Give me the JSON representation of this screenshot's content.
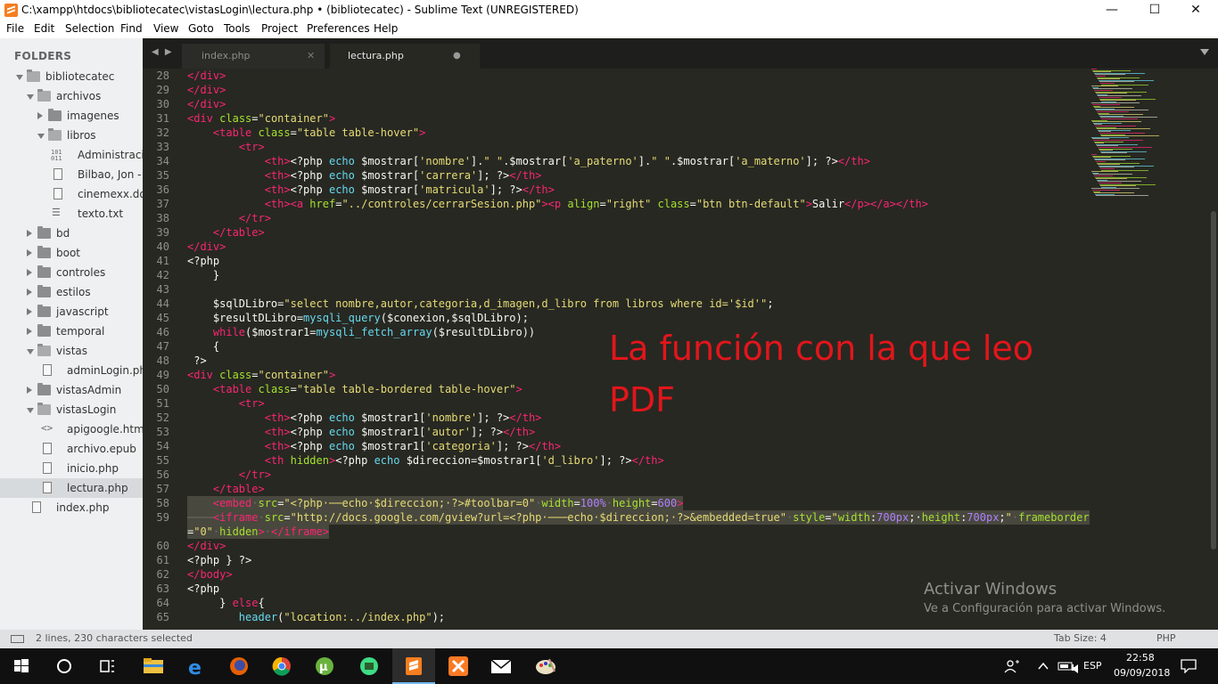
{
  "window": {
    "title": "C:\\xampp\\htdocs\\bibliotecatec\\vistasLogin\\lectura.php • (bibliotecatec) - Sublime Text (UNREGISTERED)",
    "minimize": "—",
    "maximize": "☐",
    "close": "✕"
  },
  "menu": [
    "File",
    "Edit",
    "Selection",
    "Find",
    "View",
    "Goto",
    "Tools",
    "Project",
    "Preferences",
    "Help"
  ],
  "sidebar": {
    "heading": "FOLDERS",
    "items": [
      {
        "label": "bibliotecatec",
        "type": "folder",
        "open": true,
        "depth": 0
      },
      {
        "label": "archivos",
        "type": "folder",
        "open": true,
        "depth": 1
      },
      {
        "label": "imagenes",
        "type": "folder",
        "open": false,
        "depth": 2
      },
      {
        "label": "libros",
        "type": "folder",
        "open": true,
        "depth": 2
      },
      {
        "label": "Administracin",
        "type": "binary-file",
        "depth": 3
      },
      {
        "label": "Bilbao, Jon - E",
        "type": "file",
        "depth": 3
      },
      {
        "label": "cinemexx.docx",
        "type": "file",
        "depth": 3
      },
      {
        "label": "texto.txt",
        "type": "text-file",
        "depth": 3
      },
      {
        "label": "bd",
        "type": "folder",
        "open": false,
        "depth": 1
      },
      {
        "label": "boot",
        "type": "folder",
        "open": false,
        "depth": 1
      },
      {
        "label": "controles",
        "type": "folder",
        "open": false,
        "depth": 1
      },
      {
        "label": "estilos",
        "type": "folder",
        "open": false,
        "depth": 1
      },
      {
        "label": "javascript",
        "type": "folder",
        "open": false,
        "depth": 1
      },
      {
        "label": "temporal",
        "type": "folder",
        "open": false,
        "depth": 1
      },
      {
        "label": "vistas",
        "type": "folder",
        "open": true,
        "depth": 1
      },
      {
        "label": "adminLogin.php",
        "type": "file",
        "depth": 2
      },
      {
        "label": "vistasAdmin",
        "type": "folder",
        "open": false,
        "depth": 1
      },
      {
        "label": "vistasLogin",
        "type": "folder",
        "open": true,
        "depth": 1
      },
      {
        "label": "apigoogle.html",
        "type": "code-file",
        "depth": 2
      },
      {
        "label": "archivo.epub",
        "type": "file",
        "depth": 2
      },
      {
        "label": "inicio.php",
        "type": "file",
        "depth": 2
      },
      {
        "label": "lectura.php",
        "type": "file",
        "depth": 2,
        "selected": true
      },
      {
        "label": "index.php",
        "type": "file",
        "depth": 1
      }
    ]
  },
  "tabs": {
    "nav": "◀ ▶",
    "inactive": {
      "label": "index.php",
      "close": "✕"
    },
    "active": {
      "label": "lectura.php",
      "close": "●"
    }
  },
  "editor": {
    "lines": [
      {
        "n": "28",
        "tokens": [
          [
            "t",
            "</div>"
          ]
        ]
      },
      {
        "n": "29",
        "tokens": [
          [
            "t",
            "</div>"
          ]
        ]
      },
      {
        "n": "30",
        "tokens": [
          [
            "t",
            "</div>"
          ]
        ]
      },
      {
        "n": "31",
        "tokens": [
          [
            "t",
            "<div"
          ],
          [
            "v",
            " "
          ],
          [
            "a",
            "class"
          ],
          [
            "v",
            "="
          ],
          [
            "s",
            "\"container\""
          ],
          [
            "t",
            ">"
          ]
        ]
      },
      {
        "n": "32",
        "tokens": [
          [
            "v",
            "    "
          ],
          [
            "t",
            "<table"
          ],
          [
            "v",
            " "
          ],
          [
            "a",
            "class"
          ],
          [
            "v",
            "="
          ],
          [
            "s",
            "\"table table-hover\""
          ],
          [
            "t",
            ">"
          ]
        ]
      },
      {
        "n": "33",
        "tokens": [
          [
            "v",
            "        "
          ],
          [
            "t",
            "<tr>"
          ]
        ]
      },
      {
        "n": "34",
        "tokens": [
          [
            "v",
            "            "
          ],
          [
            "t",
            "<th>"
          ],
          [
            "v",
            "<?php "
          ],
          [
            "k",
            "echo"
          ],
          [
            "v",
            " $mostrar["
          ],
          [
            "s",
            "'nombre'"
          ],
          [
            "v",
            "]."
          ],
          [
            "s",
            "\" \""
          ],
          [
            "v",
            ".$mostrar["
          ],
          [
            "s",
            "'a_paterno'"
          ],
          [
            "v",
            "]."
          ],
          [
            "s",
            "\" \""
          ],
          [
            "v",
            ".$mostrar["
          ],
          [
            "s",
            "'a_materno'"
          ],
          [
            "v",
            "]; ?>"
          ],
          [
            "t",
            "</th>"
          ]
        ]
      },
      {
        "n": "35",
        "tokens": [
          [
            "v",
            "            "
          ],
          [
            "t",
            "<th>"
          ],
          [
            "v",
            "<?php "
          ],
          [
            "k",
            "echo"
          ],
          [
            "v",
            " $mostrar["
          ],
          [
            "s",
            "'carrera'"
          ],
          [
            "v",
            "]; ?>"
          ],
          [
            "t",
            "</th>"
          ]
        ]
      },
      {
        "n": "36",
        "tokens": [
          [
            "v",
            "            "
          ],
          [
            "t",
            "<th>"
          ],
          [
            "v",
            "<?php "
          ],
          [
            "k",
            "echo"
          ],
          [
            "v",
            " $mostrar["
          ],
          [
            "s",
            "'matricula'"
          ],
          [
            "v",
            "]; ?>"
          ],
          [
            "t",
            "</th>"
          ]
        ]
      },
      {
        "n": "37",
        "tokens": [
          [
            "v",
            "            "
          ],
          [
            "t",
            "<th><a"
          ],
          [
            "v",
            " "
          ],
          [
            "a",
            "href"
          ],
          [
            "v",
            "="
          ],
          [
            "s",
            "\"../controles/cerrarSesion.php\""
          ],
          [
            "t",
            "><p"
          ],
          [
            "v",
            " "
          ],
          [
            "a",
            "align"
          ],
          [
            "v",
            "="
          ],
          [
            "s",
            "\"right\""
          ],
          [
            "v",
            " "
          ],
          [
            "a",
            "class"
          ],
          [
            "v",
            "="
          ],
          [
            "s",
            "\"btn btn-default\""
          ],
          [
            "t",
            ">"
          ],
          [
            "v",
            "Salir"
          ],
          [
            "t",
            "</p></a></th>"
          ]
        ]
      },
      {
        "n": "38",
        "tokens": [
          [
            "v",
            "        "
          ],
          [
            "t",
            "</tr>"
          ]
        ]
      },
      {
        "n": "39",
        "tokens": [
          [
            "v",
            "    "
          ],
          [
            "t",
            "</table>"
          ]
        ]
      },
      {
        "n": "40",
        "tokens": [
          [
            "t",
            "</div>"
          ]
        ]
      },
      {
        "n": "41",
        "tokens": [
          [
            "v",
            "<?php"
          ]
        ]
      },
      {
        "n": "42",
        "tokens": [
          [
            "v",
            "    }"
          ]
        ]
      },
      {
        "n": "43",
        "tokens": []
      },
      {
        "n": "44",
        "tokens": [
          [
            "v",
            "    $sqlDLibro="
          ],
          [
            "s",
            "\"select nombre,autor,categoria,d_imagen,d_libro from libros where id='$id'\""
          ],
          [
            "v",
            ";"
          ]
        ]
      },
      {
        "n": "45",
        "tokens": [
          [
            "v",
            "    $resultDLibro="
          ],
          [
            "k",
            "mysqli_query"
          ],
          [
            "v",
            "($conexion,$sqlDLibro);"
          ]
        ]
      },
      {
        "n": "46",
        "tokens": [
          [
            "v",
            "    "
          ],
          [
            "t",
            "while"
          ],
          [
            "v",
            "($mostrar1="
          ],
          [
            "k",
            "mysqli_fetch_array"
          ],
          [
            "v",
            "($resultDLibro))"
          ]
        ]
      },
      {
        "n": "47",
        "tokens": [
          [
            "v",
            "    {"
          ]
        ]
      },
      {
        "n": "48",
        "tokens": [
          [
            "v",
            " ?>"
          ]
        ]
      },
      {
        "n": "49",
        "tokens": [
          [
            "t",
            "<div"
          ],
          [
            "v",
            " "
          ],
          [
            "a",
            "class"
          ],
          [
            "v",
            "="
          ],
          [
            "s",
            "\"container\""
          ],
          [
            "t",
            ">"
          ]
        ]
      },
      {
        "n": "50",
        "tokens": [
          [
            "v",
            "    "
          ],
          [
            "t",
            "<table"
          ],
          [
            "v",
            " "
          ],
          [
            "a",
            "class"
          ],
          [
            "v",
            "="
          ],
          [
            "s",
            "\"table table-bordered table-hover\""
          ],
          [
            "t",
            ">"
          ]
        ]
      },
      {
        "n": "51",
        "tokens": [
          [
            "v",
            "        "
          ],
          [
            "t",
            "<tr>"
          ]
        ]
      },
      {
        "n": "52",
        "tokens": [
          [
            "v",
            "            "
          ],
          [
            "t",
            "<th>"
          ],
          [
            "v",
            "<?php "
          ],
          [
            "k",
            "echo"
          ],
          [
            "v",
            " $mostrar1["
          ],
          [
            "s",
            "'nombre'"
          ],
          [
            "v",
            "]; ?>"
          ],
          [
            "t",
            "</th>"
          ]
        ]
      },
      {
        "n": "53",
        "tokens": [
          [
            "v",
            "            "
          ],
          [
            "t",
            "<th>"
          ],
          [
            "v",
            "<?php "
          ],
          [
            "k",
            "echo"
          ],
          [
            "v",
            " $mostrar1["
          ],
          [
            "s",
            "'autor'"
          ],
          [
            "v",
            "]; ?>"
          ],
          [
            "t",
            "</th>"
          ]
        ]
      },
      {
        "n": "54",
        "tokens": [
          [
            "v",
            "            "
          ],
          [
            "t",
            "<th>"
          ],
          [
            "v",
            "<?php "
          ],
          [
            "k",
            "echo"
          ],
          [
            "v",
            " $mostrar1["
          ],
          [
            "s",
            "'categoria'"
          ],
          [
            "v",
            "]; ?>"
          ],
          [
            "t",
            "</th>"
          ]
        ]
      },
      {
        "n": "55",
        "tokens": [
          [
            "v",
            "            "
          ],
          [
            "t",
            "<th"
          ],
          [
            "v",
            " "
          ],
          [
            "a",
            "hidden"
          ],
          [
            "t",
            ">"
          ],
          [
            "v",
            "<?php "
          ],
          [
            "k",
            "echo"
          ],
          [
            "v",
            " $direccion=$mostrar1["
          ],
          [
            "s",
            "'d_libro'"
          ],
          [
            "v",
            "]; ?>"
          ],
          [
            "t",
            "</th>"
          ]
        ]
      },
      {
        "n": "56",
        "tokens": [
          [
            "v",
            "        "
          ],
          [
            "t",
            "</tr>"
          ]
        ]
      },
      {
        "n": "57",
        "tokens": [
          [
            "v",
            "    "
          ],
          [
            "t",
            "</table>"
          ]
        ]
      },
      {
        "n": "58",
        "selected": true,
        "tokens": [
          [
            "v",
            "    "
          ],
          [
            "t",
            "<embed"
          ],
          [
            "ws",
            "·"
          ],
          [
            "a",
            "src"
          ],
          [
            "v",
            "="
          ],
          [
            "s",
            "\"<?php·──echo·$direccion;·?>#toolbar=0\""
          ],
          [
            "ws",
            "·"
          ],
          [
            "a",
            "width"
          ],
          [
            "v",
            "="
          ],
          [
            "n",
            "100%"
          ],
          [
            "ws",
            "·"
          ],
          [
            "a",
            "height"
          ],
          [
            "v",
            "="
          ],
          [
            "n",
            "600"
          ],
          [
            "t",
            ">"
          ]
        ]
      },
      {
        "n": "59",
        "selected": true,
        "tokens": [
          [
            "ws",
            "────"
          ],
          [
            "t",
            "<iframe"
          ],
          [
            "ws",
            "·"
          ],
          [
            "a",
            "src"
          ],
          [
            "v",
            "="
          ],
          [
            "s",
            "\"http://docs.google.com/gview?url=<?php·───echo·$direccion;·?>&embedded=true\""
          ],
          [
            "ws",
            "·"
          ],
          [
            "a",
            "style"
          ],
          [
            "v",
            "="
          ],
          [
            "s",
            "\""
          ],
          [
            "a",
            "width"
          ],
          [
            "v",
            ":"
          ],
          [
            "n",
            "700px"
          ],
          [
            "v",
            ";·"
          ],
          [
            "a",
            "height"
          ],
          [
            "v",
            ":"
          ],
          [
            "n",
            "700px"
          ],
          [
            "v",
            ";"
          ],
          [
            "s",
            "\""
          ],
          [
            "ws",
            "·"
          ],
          [
            "a",
            "frameborder"
          ]
        ]
      },
      {
        "n": "",
        "selected": true,
        "tokens": [
          [
            "v",
            "="
          ],
          [
            "s",
            "\"0\""
          ],
          [
            "ws",
            "·"
          ],
          [
            "a",
            "hidden"
          ],
          [
            "t",
            ">"
          ],
          [
            "ws",
            "·"
          ],
          [
            "t",
            "</iframe>"
          ]
        ]
      },
      {
        "n": "60",
        "tokens": [
          [
            "t",
            "</div>"
          ]
        ]
      },
      {
        "n": "61",
        "tokens": [
          [
            "v",
            "<?php } ?>"
          ]
        ]
      },
      {
        "n": "62",
        "tokens": [
          [
            "t",
            "</body>"
          ]
        ]
      },
      {
        "n": "63",
        "tokens": [
          [
            "v",
            "<?php"
          ]
        ]
      },
      {
        "n": "64",
        "tokens": [
          [
            "v",
            "     } "
          ],
          [
            "t",
            "else"
          ],
          [
            "v",
            "{"
          ]
        ]
      },
      {
        "n": "65",
        "tokens": [
          [
            "v",
            "        "
          ],
          [
            "k",
            "header"
          ],
          [
            "v",
            "("
          ],
          [
            "s",
            "\"location:../index.php\""
          ],
          [
            "v",
            ");"
          ]
        ]
      }
    ]
  },
  "annotation": "La función con la que leo PDF",
  "watermark": {
    "title": "Activar Windows",
    "subtitle": "Ve a Configuración para activar Windows."
  },
  "statusbar": {
    "selection": "2 lines, 230 characters selected",
    "tab_size": "Tab Size: 4",
    "syntax": "PHP"
  },
  "taskbar": {
    "apps": [
      "windows-start",
      "cortana",
      "task-view",
      "file-explorer",
      "edge",
      "firefox",
      "chrome",
      "utorrent",
      "android",
      "sublime-text",
      "xampp",
      "mail",
      "paint"
    ],
    "language": "ESP",
    "time": "22:58",
    "date": "09/09/2018"
  },
  "colors": {
    "editor_bg": "#272822",
    "tag": "#f92672",
    "attribute": "#a6e22e",
    "string": "#e6db74",
    "keyword": "#66d9ef",
    "annotation": "#e2161b"
  }
}
